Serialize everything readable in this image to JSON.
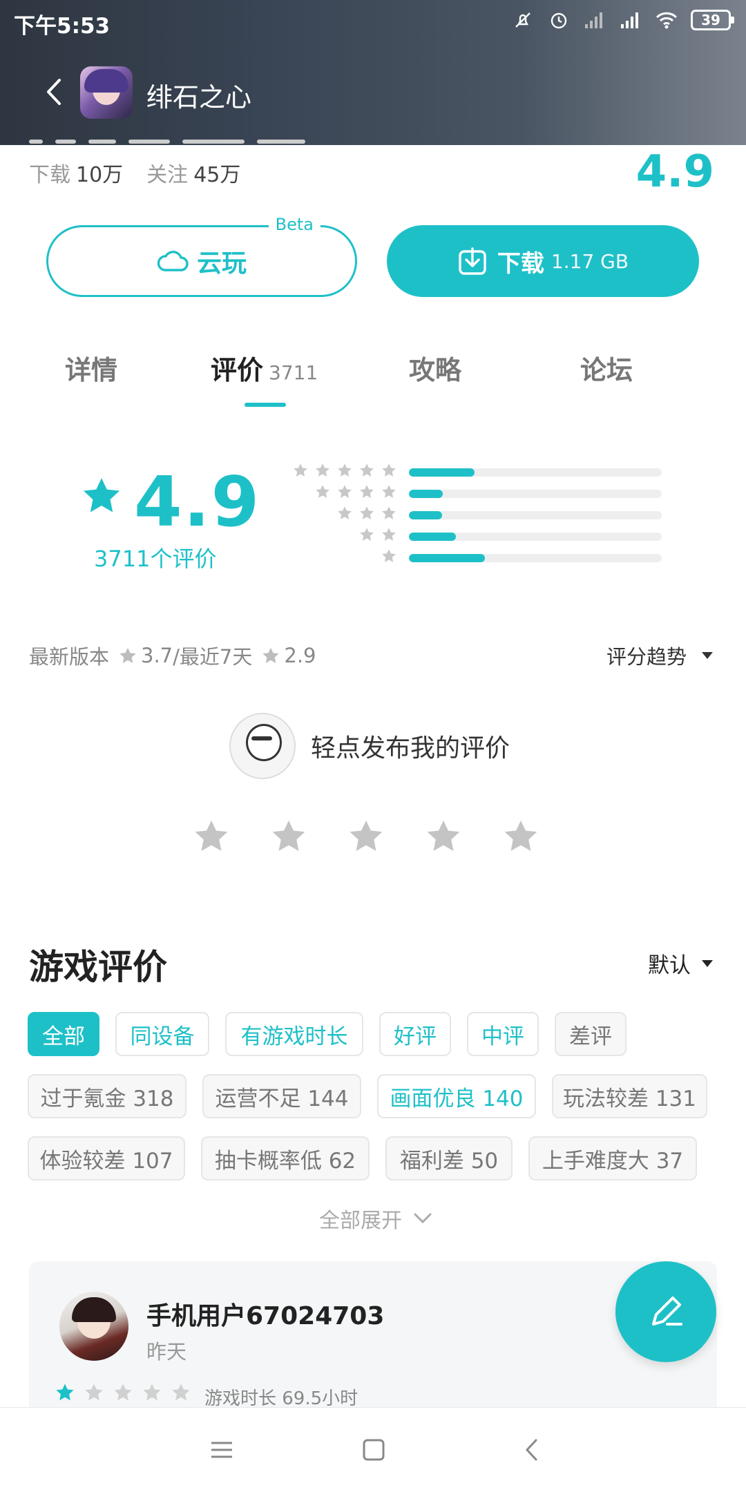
{
  "status": {
    "time": "下午5:53",
    "battery": "39"
  },
  "header": {
    "app_title": "绯石之心"
  },
  "meta": {
    "download_label": "下载",
    "download_value": "10万",
    "follow_label": "关注",
    "follow_value": "45万",
    "score": "4.9"
  },
  "buttons": {
    "cloud_label": "云玩",
    "beta": "Beta",
    "download_label": "下载",
    "download_size": "1.17 GB"
  },
  "tabs": [
    {
      "label": "详情"
    },
    {
      "label": "评价",
      "count": "3711"
    },
    {
      "label": "攻略"
    },
    {
      "label": "论坛"
    }
  ],
  "rating": {
    "score": "4.9",
    "count_text": "3711个评价",
    "distribution": [
      {
        "stars": 5,
        "fraction": 0.26
      },
      {
        "stars": 4,
        "fraction": 0.135
      },
      {
        "stars": 3,
        "fraction": 0.13
      },
      {
        "stars": 2,
        "fraction": 0.185
      },
      {
        "stars": 1,
        "fraction": 0.3
      }
    ]
  },
  "version_line": {
    "latest_label": "最新版本",
    "latest_score": "3.7",
    "sep": "/最近7天",
    "recent_score": "2.9"
  },
  "trend_label": "评分趋势",
  "publish_text": "轻点发布我的评价",
  "reviews": {
    "title": "游戏评价",
    "sort": "默认",
    "filters_row1": [
      "全部",
      "同设备",
      "有游戏时长",
      "好评",
      "中评",
      "差评"
    ],
    "tags": [
      {
        "label": "过于氪金 318"
      },
      {
        "label": "运营不足 144"
      },
      {
        "label": "画面优良 140"
      },
      {
        "label": "玩法较差 131"
      },
      {
        "label": "体验较差 107"
      },
      {
        "label": "抽卡概率低 62"
      },
      {
        "label": "福利差 50"
      },
      {
        "label": "上手难度大 37"
      }
    ],
    "expand": "全部展开",
    "first": {
      "user": "手机用户67024703",
      "time": "昨天",
      "stars": 1,
      "playtime": "游戏时长 69.5小时"
    }
  },
  "colors": {
    "accent": "#1ec0c8",
    "star_gray": "#c4c4c4"
  },
  "icons": [
    "back-arrow-icon",
    "cloud-icon",
    "download-icon",
    "star-icon",
    "chevron-down-icon",
    "edit-pen-icon",
    "menu-icon",
    "home-icon",
    "back-icon"
  ]
}
